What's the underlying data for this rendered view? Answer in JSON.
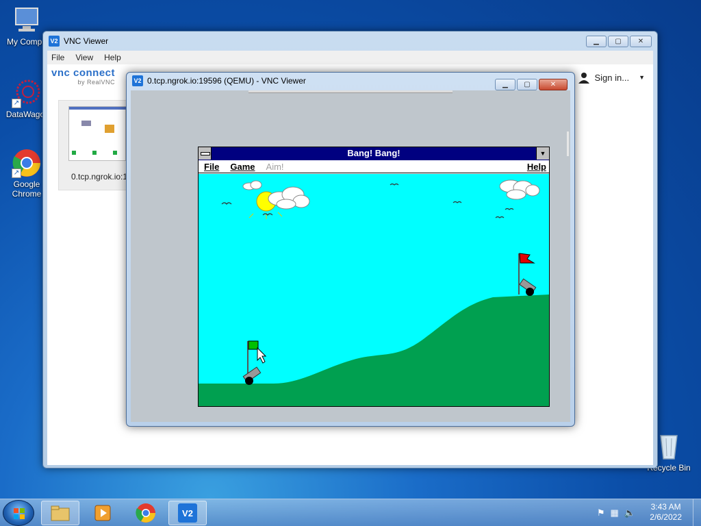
{
  "desktop": {
    "icons": [
      {
        "label": "My Compu"
      },
      {
        "label": "DataWagor"
      },
      {
        "label": "Google Chrome"
      },
      {
        "label": "Recycle Bin"
      }
    ]
  },
  "vnc_viewer": {
    "title": "VNC Viewer",
    "menu": [
      "File",
      "View",
      "Help"
    ],
    "brand": "vnc connect",
    "brand_sub": "by RealVNC",
    "sign_in": "Sign in...",
    "thumbnail_label": "0.tcp.ngrok.io:1"
  },
  "session_window": {
    "title": "0.tcp.ngrok.io:19596 (QEMU) - VNC Viewer"
  },
  "app": {
    "title": "Bang! Bang!",
    "menu": {
      "file": "File",
      "game": "Game",
      "aim": "Aim!",
      "help": "Help"
    }
  },
  "colors": {
    "sky": "#00ffff",
    "hill": "#00a050",
    "player_flag": "#00c000",
    "enemy_flag": "#e00000",
    "titlebar_31": "#000080"
  },
  "taskbar": {
    "time": "3:43 AM",
    "date": "2/6/2022"
  }
}
